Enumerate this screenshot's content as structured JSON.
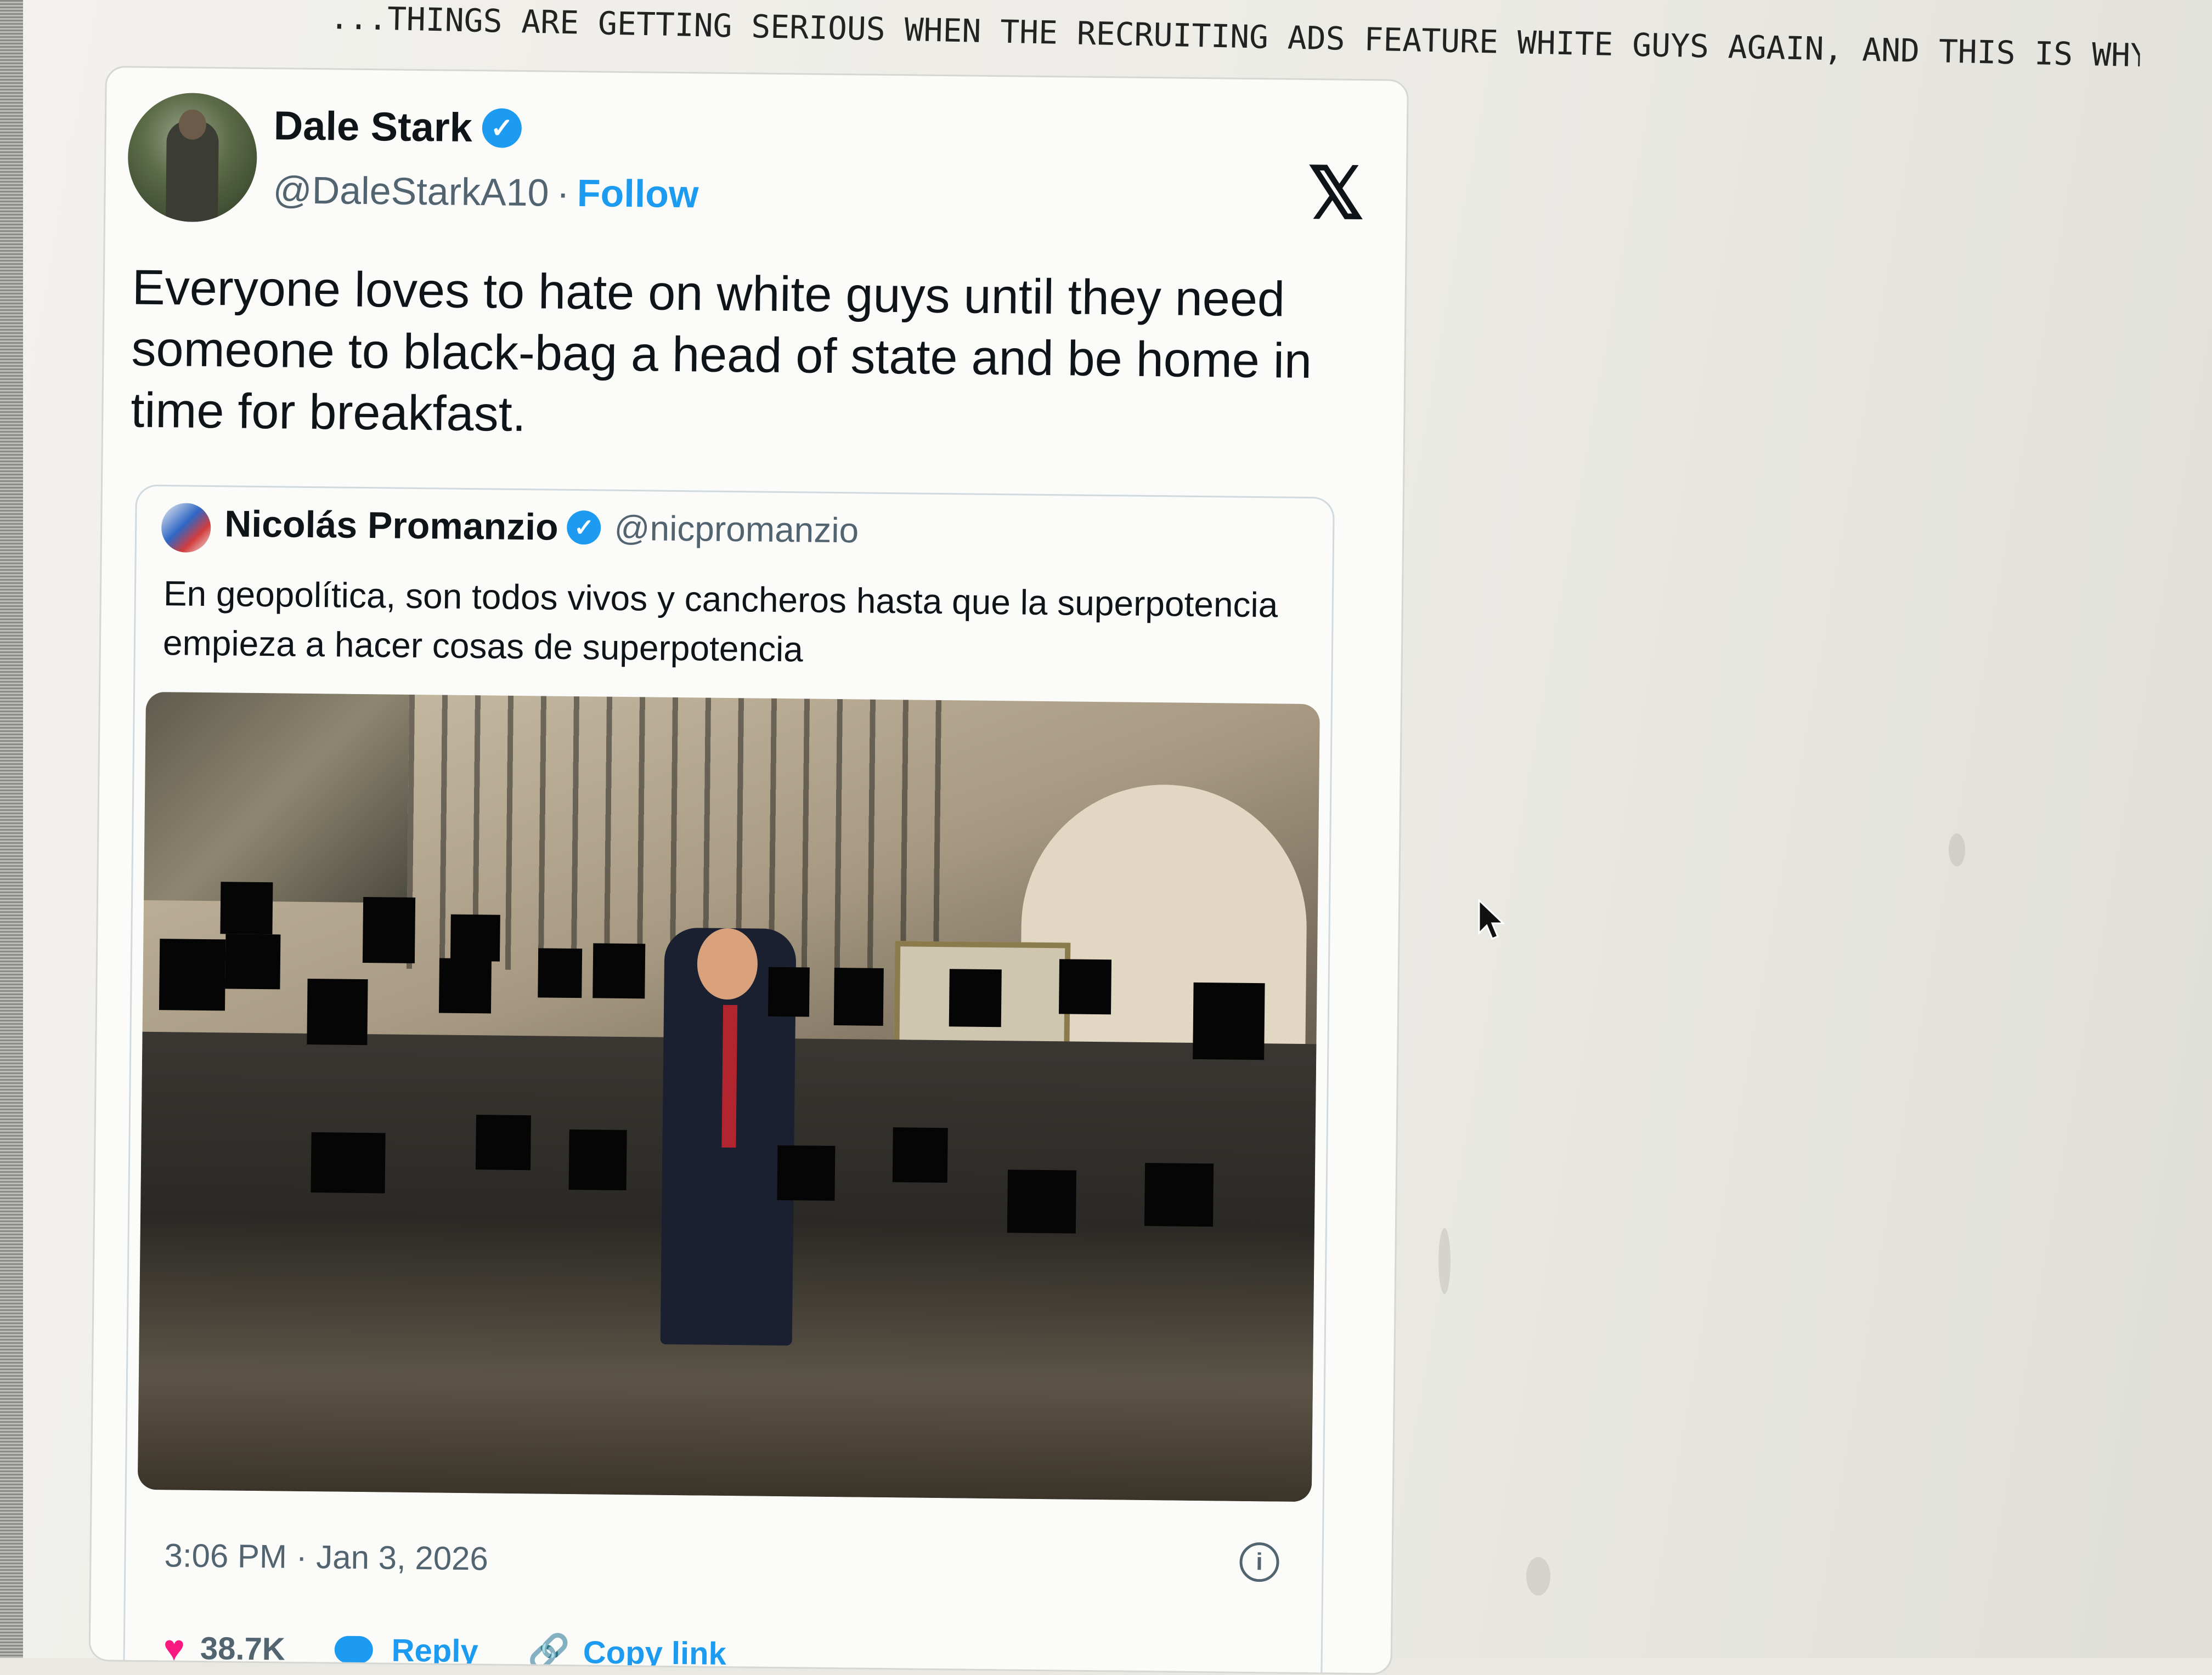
{
  "page": {
    "headline": "...THINGS ARE GETTING SERIOUS WHEN THE RECRUITING ADS FEATURE WHITE GUYS AGAIN, AND THIS IS WHY:"
  },
  "tweet": {
    "display_name": "Dale Stark",
    "handle": "@DaleStarkA10",
    "separator": "·",
    "follow_label": "Follow",
    "platform_logo": "𝕏",
    "text": "Everyone loves to hate on white guys until they need someone to black-bag a head of state and be home in time for breakfast.",
    "timestamp": "3:06 PM · Jan 3, 2026",
    "likes": "38.7K",
    "reply_label": "Reply",
    "copy_link_label": "Copy link"
  },
  "quoted_tweet": {
    "display_name": "Nicolás Promanzio",
    "handle": "@nicpromanzio",
    "text": "En geopolítica, son todos vivos y cancheros hasta que la superpotencia empieza a hacer cosas de superpotencia"
  },
  "icons": {
    "verified": "verified-badge-icon",
    "info": "info-icon",
    "like": "heart-icon",
    "reply": "reply-icon",
    "copy_link": "link-icon",
    "logo": "x-logo-icon"
  },
  "colors": {
    "accent": "#1d9bf0",
    "like": "#f91880",
    "secondary_text": "#536471"
  }
}
